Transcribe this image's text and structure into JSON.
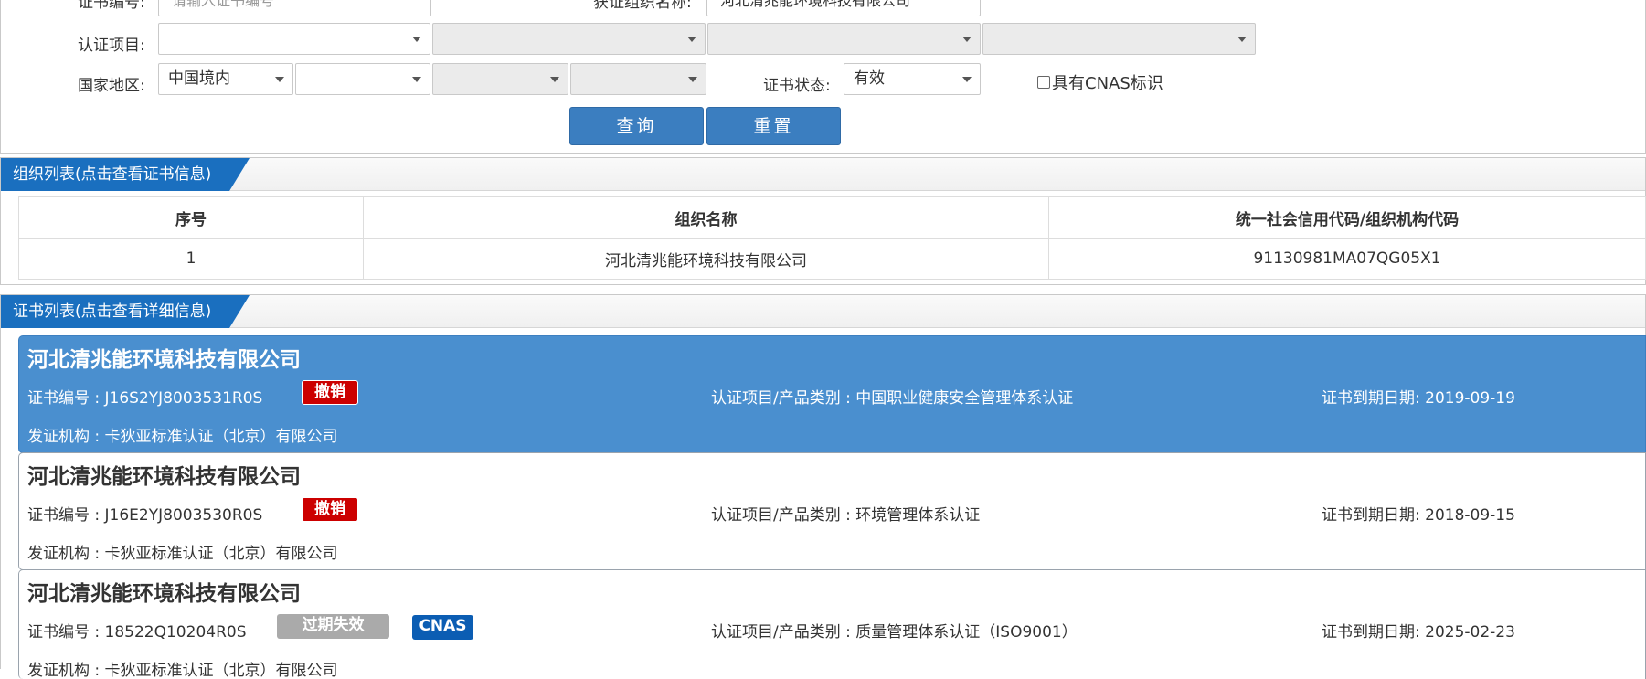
{
  "search_form": {
    "cert_no_label": "证书编号:",
    "cert_no_placeholder": "请输入证书编号",
    "org_name_label": "获证组织名称:",
    "org_name_value": "河北清兆能环境科技有限公司",
    "project_label": "认证项目:",
    "project_selects": [
      "",
      "",
      "",
      ""
    ],
    "region_label": "国家地区:",
    "region_selects": [
      "中国境内",
      "",
      "",
      ""
    ],
    "status_label": "证书状态:",
    "status_value": "有效",
    "cnas_checkbox_label": "具有CNAS标识",
    "query_button": "查询",
    "reset_button": "重置"
  },
  "org_section": {
    "title": "组织列表(点击查看证书信息)",
    "columns": [
      "序号",
      "组织名称",
      "统一社会信用代码/组织机构代码"
    ],
    "rows": [
      [
        "1",
        "河北清兆能环境科技有限公司",
        "91130981MA07QG05X1"
      ]
    ]
  },
  "cert_section": {
    "title": "证书列表(点击查看详细信息)",
    "items": [
      {
        "org_name": "河北清兆能环境科技有限公司",
        "cert_no": "证书编号 : J16S2YJ8003531R0S",
        "status_badge": "撤销",
        "project": "认证项目/产品类别 : 中国职业健康安全管理体系认证",
        "expiry": "证书到期日期: 2019-09-19",
        "issuer": "发证机构 : 卡狄亚标准认证（北京）有限公司"
      },
      {
        "org_name": "河北清兆能环境科技有限公司",
        "cert_no": "证书编号 : J16E2YJ8003530R0S",
        "status_badge": "撤销",
        "project": "认证项目/产品类别 : 环境管理体系认证",
        "expiry": "证书到期日期: 2018-09-15",
        "issuer": "发证机构 : 卡狄亚标准认证（北京）有限公司"
      },
      {
        "org_name": "河北清兆能环境科技有限公司",
        "cert_no": "证书编号 : 18522Q10204R0S",
        "status_badge": "过期失效",
        "extra_badge": "CNAS",
        "project": "认证项目/产品类别 : 质量管理体系认证（ISO9001）",
        "expiry": "证书到期日期: 2025-02-23",
        "issuer": "发证机构 : 卡狄亚标准认证（北京）有限公司"
      }
    ]
  },
  "colors": {
    "accent": "#1a6fbf",
    "button": "#3b7ec0",
    "selected_row": "#4a8fcf",
    "revoked": "#cc0000",
    "expired": "#aaaaaa",
    "cnas": "#0b5db3"
  }
}
